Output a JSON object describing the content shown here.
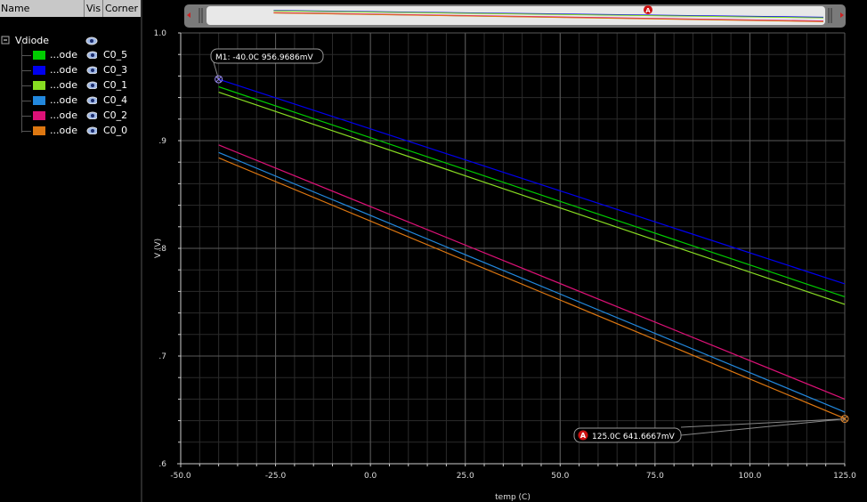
{
  "legend_panel": {
    "col_name": "Name",
    "col_vis": "Vis",
    "col_corner": "Corner",
    "group_name": "Vdiode",
    "items": [
      {
        "label": "...ode",
        "corner": "C0_5",
        "color": "#00cc00"
      },
      {
        "label": "...ode",
        "corner": "C0_3",
        "color": "#0000ee"
      },
      {
        "label": "...ode",
        "corner": "C0_1",
        "color": "#88dd22"
      },
      {
        "label": "...ode",
        "corner": "C0_4",
        "color": "#2288dd"
      },
      {
        "label": "...ode",
        "corner": "C0_2",
        "color": "#dd1177"
      },
      {
        "label": "...ode",
        "corner": "C0_0",
        "color": "#dd7711"
      }
    ]
  },
  "markers": {
    "m1": {
      "text": "M1: -40.0C 956.9686mV",
      "x": -40,
      "y": 0.9569686
    },
    "a": {
      "badge": "A",
      "text": "125.0C 641.6667mV",
      "x": 125,
      "y": 0.6416667
    }
  },
  "chart_data": {
    "type": "line",
    "xlabel": "temp (C)",
    "ylabel": "V (V)",
    "xlim": [
      -50,
      125
    ],
    "ylim": [
      0.6,
      1.0
    ],
    "xticks": [
      -50,
      -25,
      0,
      25,
      50,
      75,
      100,
      125
    ],
    "xtick_labels": [
      "-50.0",
      "-25.0",
      "0.0",
      "25.0",
      "50.0",
      "75.0",
      "100.0",
      "125.0"
    ],
    "yticks": [
      0.6,
      0.7,
      0.8,
      0.9,
      1.0
    ],
    "ytick_labels": [
      ".6",
      ".7",
      ".8",
      ".9",
      "1.0"
    ],
    "grid": true,
    "series": [
      {
        "name": "C0_5",
        "color": "#00cc00",
        "x": [
          -40,
          125
        ],
        "y": [
          0.95,
          0.755
        ]
      },
      {
        "name": "C0_3",
        "color": "#0000ee",
        "x": [
          -40,
          125
        ],
        "y": [
          0.957,
          0.767
        ]
      },
      {
        "name": "C0_1",
        "color": "#88dd22",
        "x": [
          -40,
          125
        ],
        "y": [
          0.945,
          0.748
        ]
      },
      {
        "name": "C0_4",
        "color": "#2288dd",
        "x": [
          -40,
          125
        ],
        "y": [
          0.889,
          0.648
        ]
      },
      {
        "name": "C0_2",
        "color": "#dd1177",
        "x": [
          -40,
          125
        ],
        "y": [
          0.896,
          0.66
        ]
      },
      {
        "name": "C0_0",
        "color": "#dd7711",
        "x": [
          -40,
          125
        ],
        "y": [
          0.884,
          0.642
        ]
      }
    ]
  }
}
